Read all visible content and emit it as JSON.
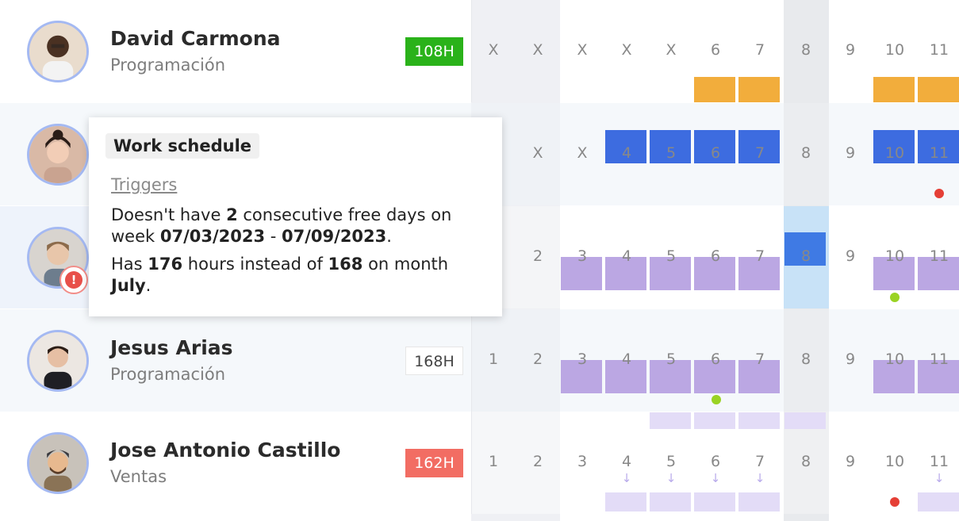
{
  "rows": [
    {
      "name": "David Carmona",
      "dept": "Programación",
      "hours": "108H",
      "days": [
        "X",
        "X",
        "X",
        "X",
        "X",
        "6",
        "7",
        "8",
        "9",
        "10",
        "11"
      ]
    },
    {
      "name": "",
      "dept": "",
      "hours": "",
      "days": [
        "",
        "X",
        "X",
        "4",
        "5",
        "6",
        "7",
        "8",
        "9",
        "10",
        "11"
      ]
    },
    {
      "name": "",
      "dept": "",
      "hours": "",
      "days": [
        "",
        "2",
        "3",
        "4",
        "5",
        "6",
        "7",
        "8",
        "9",
        "10",
        "11"
      ]
    },
    {
      "name": "Jesus Arias",
      "dept": "Programación",
      "hours": "168H",
      "days": [
        "1",
        "2",
        "3",
        "4",
        "5",
        "6",
        "7",
        "8",
        "9",
        "10",
        "11"
      ]
    },
    {
      "name": "Jose Antonio Castillo",
      "dept": "Ventas",
      "hours": "162H",
      "days": [
        "1",
        "2",
        "3",
        "4",
        "5",
        "6",
        "7",
        "8",
        "9",
        "10",
        "11"
      ]
    }
  ],
  "tooltip": {
    "title": "Work schedule",
    "triggers": "Triggers",
    "l1a": "Doesn't have ",
    "l1b": "2",
    "l1c": " consecutive free days on week ",
    "l1d": "07/03/2023",
    "l1e": " - ",
    "l1f": "07/09/2023",
    "l1g": ".",
    "l2a": "Has ",
    "l2b": "176",
    "l2c": " hours instead of ",
    "l2d": "168",
    "l2e": " on month ",
    "l2f": "July",
    "l2g": "."
  },
  "alert_icon": "!",
  "colors": {
    "orange": "#f2ad3c",
    "blue": "#3d6ce0",
    "purple": "#bba7e3",
    "green_badge": "#2ab21a",
    "red_badge": "#f26d63"
  }
}
